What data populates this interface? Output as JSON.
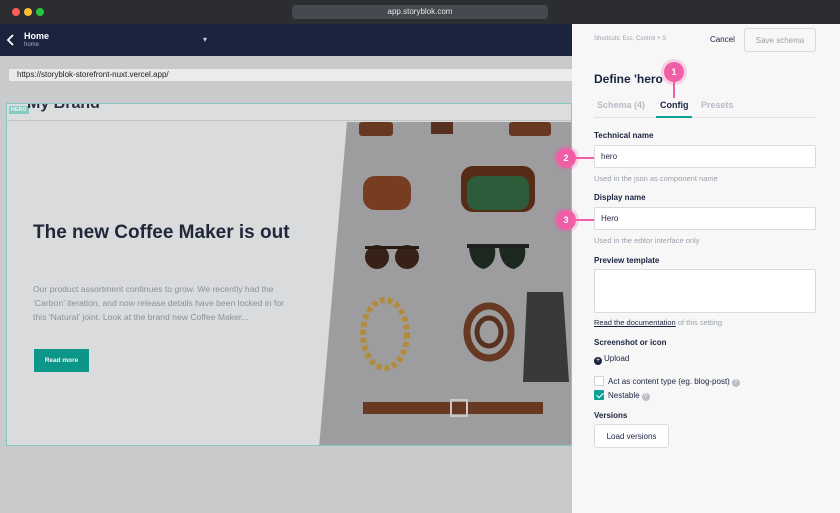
{
  "window": {
    "url": "app.storyblok.com"
  },
  "header": {
    "title": "Home",
    "subtitle": "home"
  },
  "preview": {
    "address": "https://storyblok-storefront-nuxt.vercel.app/",
    "hero_tag": "HERO",
    "brand": "My Brand",
    "hero_title": "The new Coffee Maker is out",
    "hero_text": "Our product assortment continues to grow. We recently had the ‘Carbon’ iteration, and now release details have been locked in for this ‘Natural’ joint. Look at the brand new Coffee Maker...",
    "read_more": "Read more"
  },
  "panel": {
    "shortcuts": "Shortcuts: Esc, Control + S",
    "cancel": "Cancel",
    "save": "Save schema",
    "title": "Define 'hero",
    "tabs": [
      {
        "label": "Schema (4)"
      },
      {
        "label": "Config"
      },
      {
        "label": "Presets"
      }
    ],
    "technical_name_label": "Technical name",
    "technical_name_value": "hero",
    "technical_name_hint": "Used in the json as component name",
    "display_name_label": "Display name",
    "display_name_value": "Hero",
    "display_name_hint": "Used in the editor interface only",
    "preview_template_label": "Preview template",
    "doc_link": "Read the documentation",
    "doc_suffix": " of this setting",
    "screenshot_label": "Screenshot or icon",
    "upload": "Upload",
    "content_type_label": "Act as content type (eg. blog-post)",
    "nestable_label": "Nestable",
    "versions_label": "Versions",
    "load_versions": "Load versions"
  },
  "callouts": [
    "1",
    "2",
    "3"
  ],
  "colors": {
    "accent": "#0aa197",
    "header": "#1b243f",
    "callout": "#f05fa6"
  }
}
